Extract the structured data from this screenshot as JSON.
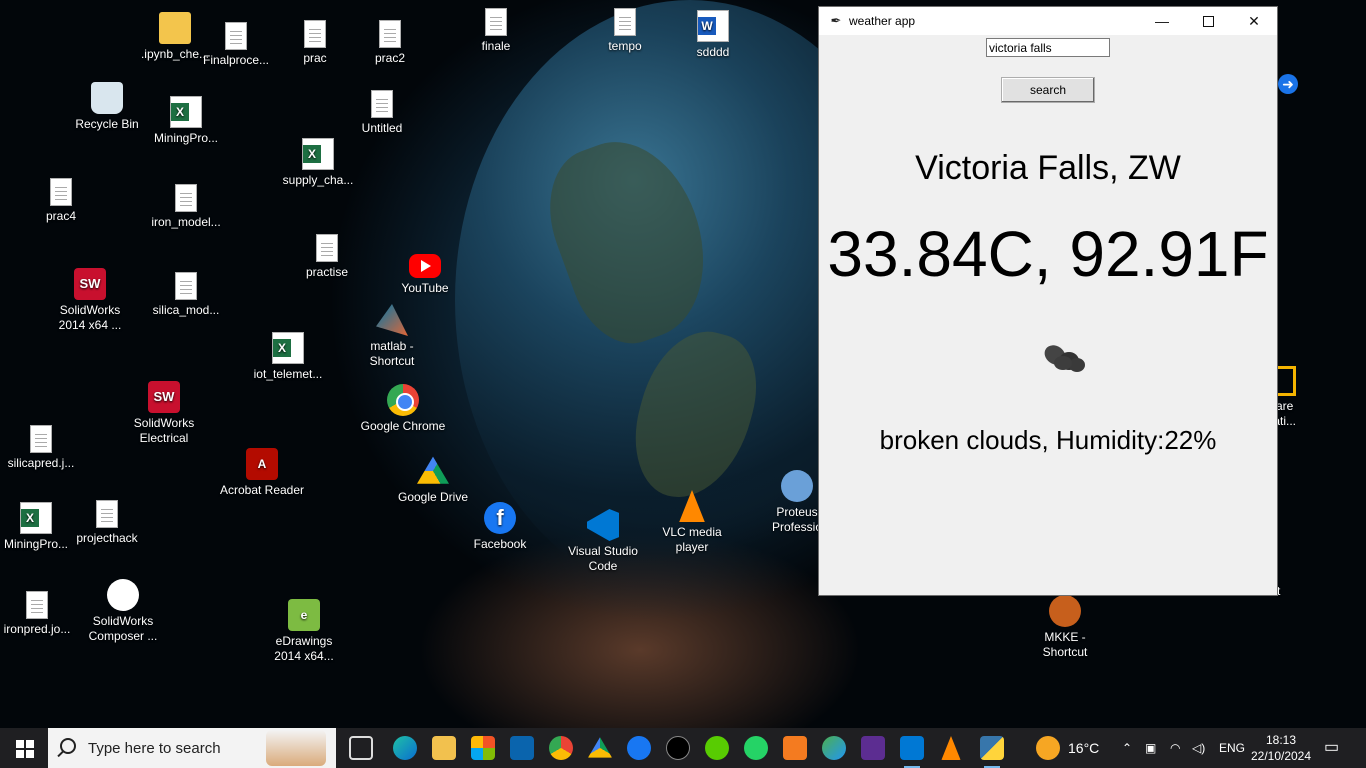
{
  "desktop": {
    "icons": [
      {
        "label": ".ipynb_che..."
      },
      {
        "label": "Finalproce..."
      },
      {
        "label": "prac"
      },
      {
        "label": "prac2"
      },
      {
        "label": "finale"
      },
      {
        "label": "tempo"
      },
      {
        "label": "sdddd"
      },
      {
        "label": "Recycle Bin"
      },
      {
        "label": "MiningPro..."
      },
      {
        "label": "Untitled"
      },
      {
        "label": "supply_cha..."
      },
      {
        "label": "prac4"
      },
      {
        "label": "iron_model..."
      },
      {
        "label": "practise"
      },
      {
        "label": "YouTube"
      },
      {
        "label": "SolidWorks 2014 x64 ..."
      },
      {
        "label": "silica_mod..."
      },
      {
        "label": "matlab - Shortcut"
      },
      {
        "label": "iot_telemet..."
      },
      {
        "label": "SolidWorks Electrical"
      },
      {
        "label": "Google Chrome"
      },
      {
        "label": "silicapred.j..."
      },
      {
        "label": "Acrobat Reader"
      },
      {
        "label": "Google Drive"
      },
      {
        "label": "Facebook"
      },
      {
        "label": "Visual Studio Code"
      },
      {
        "label": "VLC media player"
      },
      {
        "label": "Proteus Professio"
      },
      {
        "label": "MiningPro..."
      },
      {
        "label": "projecthack"
      },
      {
        "label": "ironpred.jo..."
      },
      {
        "label": "SolidWorks Composer ..."
      },
      {
        "label": "eDrawings 2014 x64..."
      },
      {
        "label": "MKKE - Shortcut"
      }
    ],
    "partial_labels": [
      "vare",
      "tati...",
      "t"
    ]
  },
  "window": {
    "title": "weather app",
    "search_value": "victoria falls",
    "search_button": "search",
    "city": "Victoria Falls, ZW",
    "temperature": "33.84C, 92.91F",
    "description": "broken clouds, Humidity:22%"
  },
  "taskbar": {
    "search_placeholder": "Type here to search",
    "weather_temp": "16°C",
    "language": "ENG",
    "time": "18:13",
    "date": "22/10/2024"
  }
}
